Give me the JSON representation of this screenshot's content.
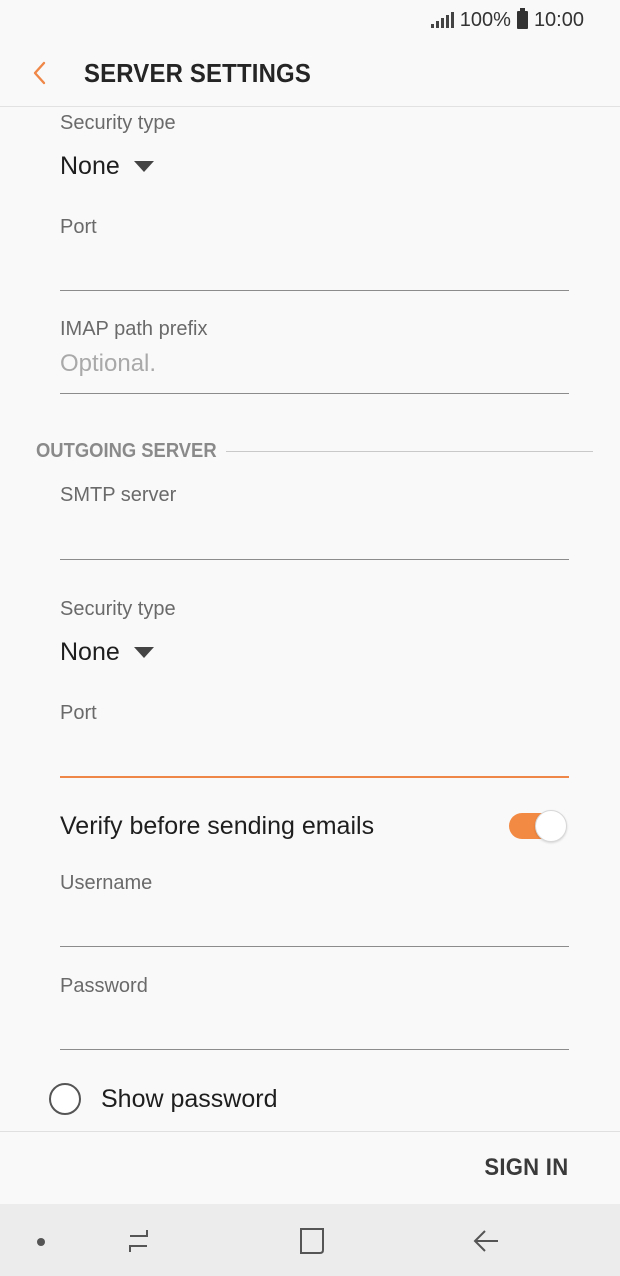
{
  "status_bar": {
    "battery": "100%",
    "time": "10:00"
  },
  "header": {
    "title": "SERVER SETTINGS"
  },
  "incoming": {
    "security_type_label": "Security type",
    "security_type_value": "None",
    "port_label": "Port",
    "imap_prefix_label": "IMAP path prefix",
    "imap_prefix_placeholder": "Optional."
  },
  "outgoing": {
    "section_title": "OUTGOING SERVER",
    "smtp_label": "SMTP server",
    "security_type_label": "Security type",
    "security_type_value": "None",
    "port_label": "Port",
    "verify_label": "Verify before sending emails",
    "verify_on": true,
    "username_label": "Username",
    "password_label": "Password",
    "show_password_label": "Show password"
  },
  "footer": {
    "sign_in_label": "SIGN IN"
  },
  "colors": {
    "accent": "#f38a43",
    "background": "#f9f9f9"
  }
}
